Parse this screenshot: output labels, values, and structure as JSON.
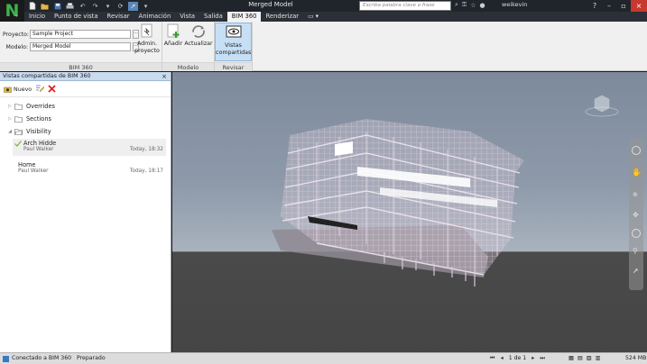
{
  "window": {
    "title": "Merged Model"
  },
  "search": {
    "placeholder": "Escriba palabra clave o frase"
  },
  "user": {
    "name": "weikevin"
  },
  "tabs": [
    "Inicio",
    "Punto de vista",
    "Revisar",
    "Animación",
    "Vista",
    "Salida",
    "BIM 360",
    "Renderizar"
  ],
  "active_tab": "BIM 360",
  "ribbon": {
    "project_label": "Proyecto:",
    "project_value": "Sample Project",
    "model_label": "Modelo:",
    "model_value": "Merged Model",
    "browse_btn": "···",
    "panel_bim360": "BIM 360",
    "admin_btn_line1": "Admin.",
    "admin_btn_line2": "proyecto",
    "panel_modelo": "Modelo",
    "add_btn": "Añadir",
    "update_btn": "Actualizar",
    "panel_revisar": "Revisar",
    "shared_btn_line1": "Vistas",
    "shared_btn_line2": "compartidas"
  },
  "sidebar": {
    "title": "Vistas compartidas de BIM 360",
    "close": "×",
    "new_label": "Nuevo",
    "folders": [
      "Overrides",
      "Sections",
      "Visibility"
    ],
    "views": [
      {
        "name": "Arch Hidde",
        "user": "Paul Walker",
        "date": "Today, 18:32",
        "checked": true
      },
      {
        "name": "Home",
        "user": "Paul Walker",
        "date": "Today, 18:17",
        "checked": false
      }
    ]
  },
  "status": {
    "left": "Conectado a BIM 360",
    "middle": "Preparado",
    "page": "1 de 1",
    "memory": "524 MB"
  },
  "colors": {
    "accent": "#5b87b8",
    "folder": "#c7a33f",
    "check": "#4b9e2e",
    "title_bg": "#20252c"
  }
}
